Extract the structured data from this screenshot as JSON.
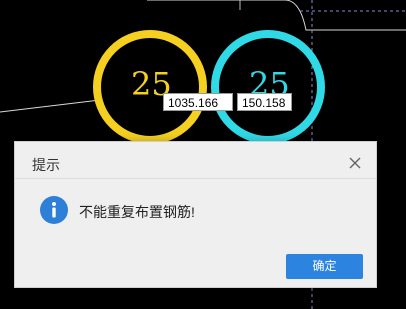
{
  "canvas": {
    "left_circle_label": "25",
    "right_circle_label": "25",
    "coord_x": "1035.166",
    "coord_y": "150.158",
    "colors": {
      "left_circle": "#f5d020",
      "right_circle": "#2fd9e6"
    }
  },
  "dialog": {
    "title": "提示",
    "icon": "info-icon",
    "close_icon": "close-icon",
    "message": "不能重复布置钢筋!",
    "ok_label": "确定",
    "colors": {
      "button": "#2d84e0",
      "info_icon": "#2d7fd7"
    }
  }
}
